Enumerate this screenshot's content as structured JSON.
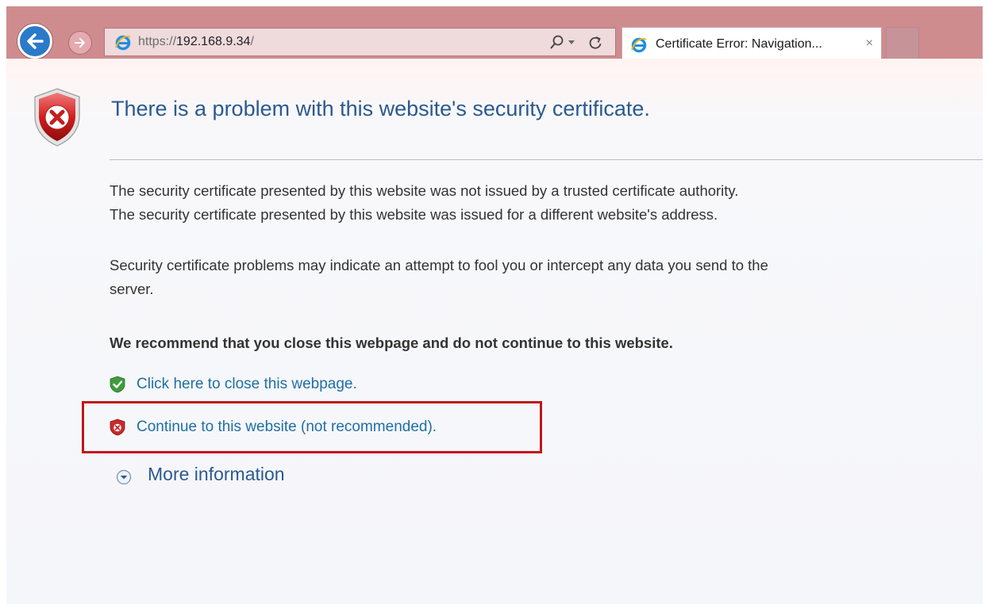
{
  "browser": {
    "address": {
      "scheme": "https://",
      "host": "192.168.9.34",
      "path": "/"
    },
    "tab": {
      "title": "Certificate Error: Navigation...",
      "close_glyph": "×"
    },
    "colors": {
      "chrome": "#cf8c8f",
      "back_button": "#2a7ac9"
    }
  },
  "page": {
    "title": "There is a problem with this website's security certificate.",
    "reasons": [
      "The security certificate presented by this website was not issued by a trusted certificate authority.",
      "The security certificate presented by this website was issued for a different website's address."
    ],
    "warning": [
      "Security certificate problems may indicate an attempt to fool you or intercept any data you send to the",
      "server."
    ],
    "recommendation": "We recommend that you close this webpage and do not continue to this website.",
    "close_link": "Click here to close this webpage.",
    "continue_link": "Continue to this website (not recommended).",
    "more_info": "More information",
    "colors": {
      "title": "#2a5a8f",
      "link": "#1f6fa5",
      "highlight_box": "#c0151a"
    },
    "icons": {
      "header": "red-shield-x-icon",
      "close_link": "green-shield-check-icon",
      "continue_link": "red-shield-x-icon",
      "more_info": "expand-circle-icon"
    }
  }
}
